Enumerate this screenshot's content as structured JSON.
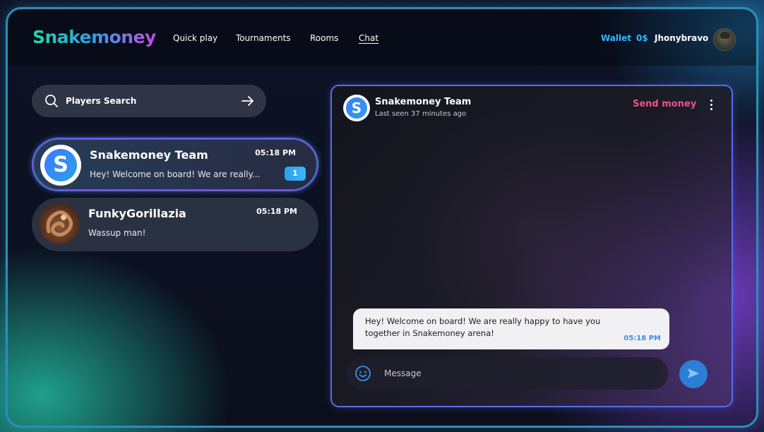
{
  "app": {
    "logo_text": "Snakemoney",
    "colors": {
      "accent_blue": "#35b6ff",
      "accent_pink": "#f0508a",
      "frame": "#2a8fb8"
    }
  },
  "nav": {
    "items": [
      {
        "label": "Quick play",
        "active": false
      },
      {
        "label": "Tournaments",
        "active": false
      },
      {
        "label": "Rooms",
        "active": false
      },
      {
        "label": "Chat",
        "active": true
      }
    ]
  },
  "header": {
    "wallet_label": "Wallet",
    "balance": "0$",
    "username": "Jhonybravo"
  },
  "search": {
    "placeholder": "Players Search",
    "icon": "search-icon",
    "submit_icon": "arrow-right-icon"
  },
  "conversations": [
    {
      "name": "Snakemoney Team",
      "time": "05:18 PM",
      "preview": "Hey! Welcome on board! We are really...",
      "unread": "1",
      "avatar_letter": "S",
      "active": true
    },
    {
      "name": "FunkyGorillazia",
      "time": "05:18 PM",
      "preview": "Wassup man!",
      "unread": "",
      "active": false
    }
  ],
  "chat": {
    "contact_name": "Snakemoney Team",
    "avatar_letter": "S",
    "last_seen": "Last seen 37 minutes ago",
    "send_money_label": "Send money",
    "messages": [
      {
        "text": "Hey! Welcome on board! We are really happy to have you together in Snakemoney arena!",
        "time": "05:18 PM",
        "incoming": true
      }
    ],
    "composer_placeholder": "Message"
  }
}
